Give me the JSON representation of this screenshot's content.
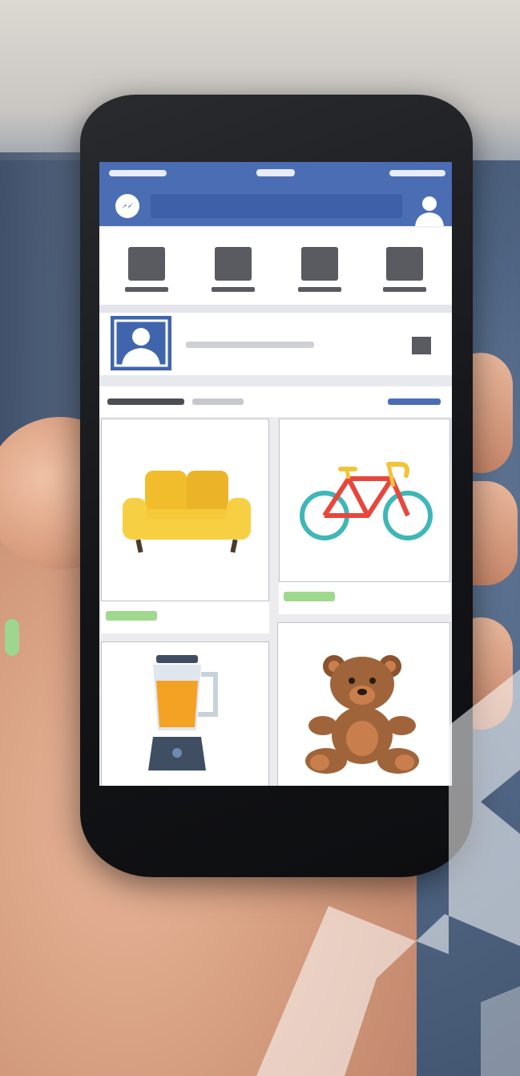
{
  "scene": {
    "background_colors": {
      "wall": "#dcd8d2",
      "couch": "#4f6482",
      "skin": "#d59d80",
      "nail": "#9ed58f"
    }
  },
  "app": {
    "brand_color": "#4b6db4",
    "header": {
      "messenger_icon": "messenger-icon",
      "search_placeholder": "",
      "profile_icon": "user-silhouette-icon"
    },
    "shortcuts": [
      {
        "icon": "placeholder-square-icon"
      },
      {
        "icon": "placeholder-square-icon"
      },
      {
        "icon": "placeholder-square-icon"
      },
      {
        "icon": "placeholder-square-icon"
      }
    ],
    "profile_row": {
      "avatar_icon": "user-silhouette-icon",
      "action_icon": "placeholder-square-icon"
    },
    "tabs": {
      "active_color": "#4d4e52",
      "inactive_color": "#c7c8cc",
      "link_color": "#4b6db4"
    },
    "listings": [
      {
        "item": "sofa",
        "icon": "sofa-icon",
        "price_color": "#9fd98e"
      },
      {
        "item": "bicycle",
        "icon": "bicycle-icon",
        "price_color": "#9fd98e"
      },
      {
        "item": "blender",
        "icon": "blender-icon"
      },
      {
        "item": "teddy bear",
        "icon": "teddy-bear-icon"
      }
    ]
  }
}
